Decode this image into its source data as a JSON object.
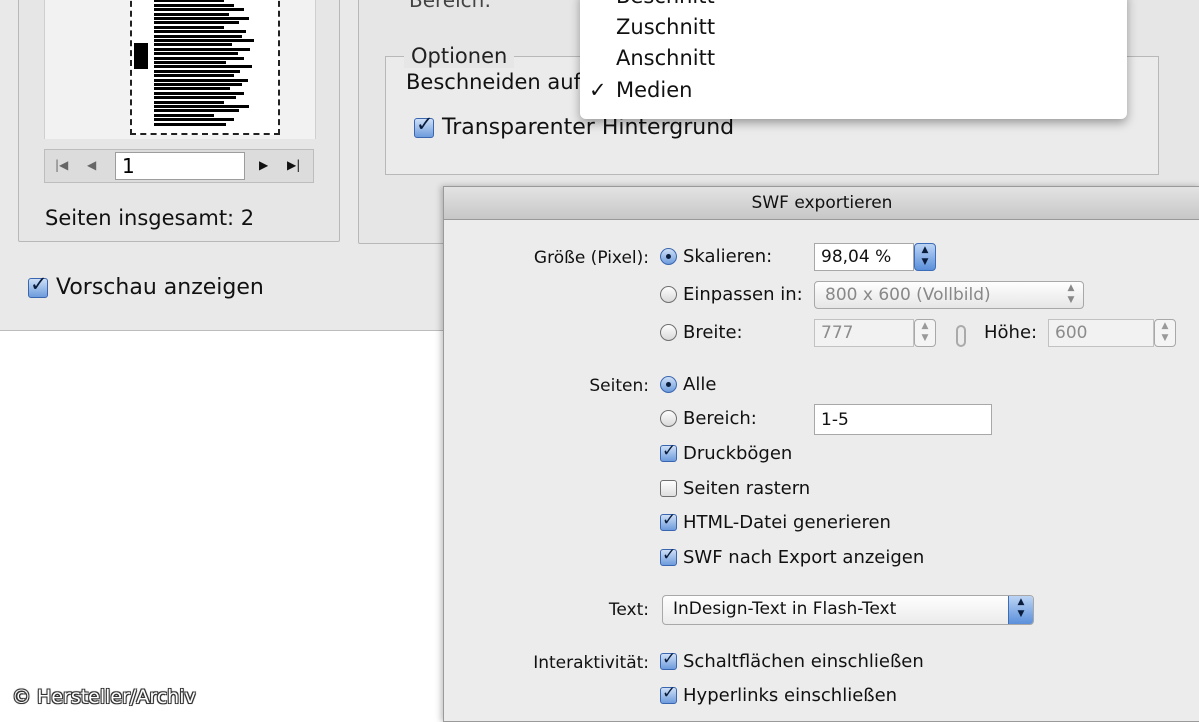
{
  "background_dialog": {
    "page_field_value": "1",
    "pages_total": "Seiten insgesamt: 2",
    "preview_label": "Vorschau anzeigen",
    "preview_checked": true,
    "range_label_partial": "Bereich:",
    "options_legend": "Optionen",
    "crop_label_partial": "Beschneiden auf",
    "transparent_label": "Transparenter Hintergrund",
    "transparent_checked": true,
    "popup_menu": {
      "items": [
        {
          "label": "Beschnitt",
          "checked": false
        },
        {
          "label": "Zuschnitt",
          "checked": false
        },
        {
          "label": "Anschnitt",
          "checked": false
        },
        {
          "label": "Medien",
          "checked": true
        }
      ]
    }
  },
  "swf_dialog": {
    "title": "SWF exportieren",
    "size_label": "Größe (Pixel):",
    "scale_label": "Skalieren:",
    "scale_value": "98,04 %",
    "fit_label": "Einpassen in:",
    "fit_value": "800 x 600 (Vollbild)",
    "width_label": "Breite:",
    "width_value": "777",
    "height_label": "Höhe:",
    "height_value": "600",
    "size_mode": "scale",
    "pages_label": "Seiten:",
    "pages_all_label": "Alle",
    "pages_range_label": "Bereich:",
    "pages_range_value": "1-5",
    "pages_mode": "all",
    "spreads_label": "Druckbögen",
    "spreads_checked": true,
    "rasterize_label": "Seiten rastern",
    "rasterize_checked": false,
    "html_label": "HTML-Datei generieren",
    "html_checked": true,
    "view_label": "SWF nach Export anzeigen",
    "view_checked": true,
    "text_label": "Text:",
    "text_value": "InDesign-Text in Flash-Text",
    "interactivity_label": "Interaktivität:",
    "buttons_label": "Schaltflächen einschließen",
    "buttons_checked": true,
    "hyperlinks_label": "Hyperlinks einschließen",
    "hyperlinks_checked": true
  },
  "copyright": "© Hersteller/Archiv",
  "colors": {
    "accent_blue": "#6d9bdc",
    "dialog_bg": "#ececec"
  }
}
